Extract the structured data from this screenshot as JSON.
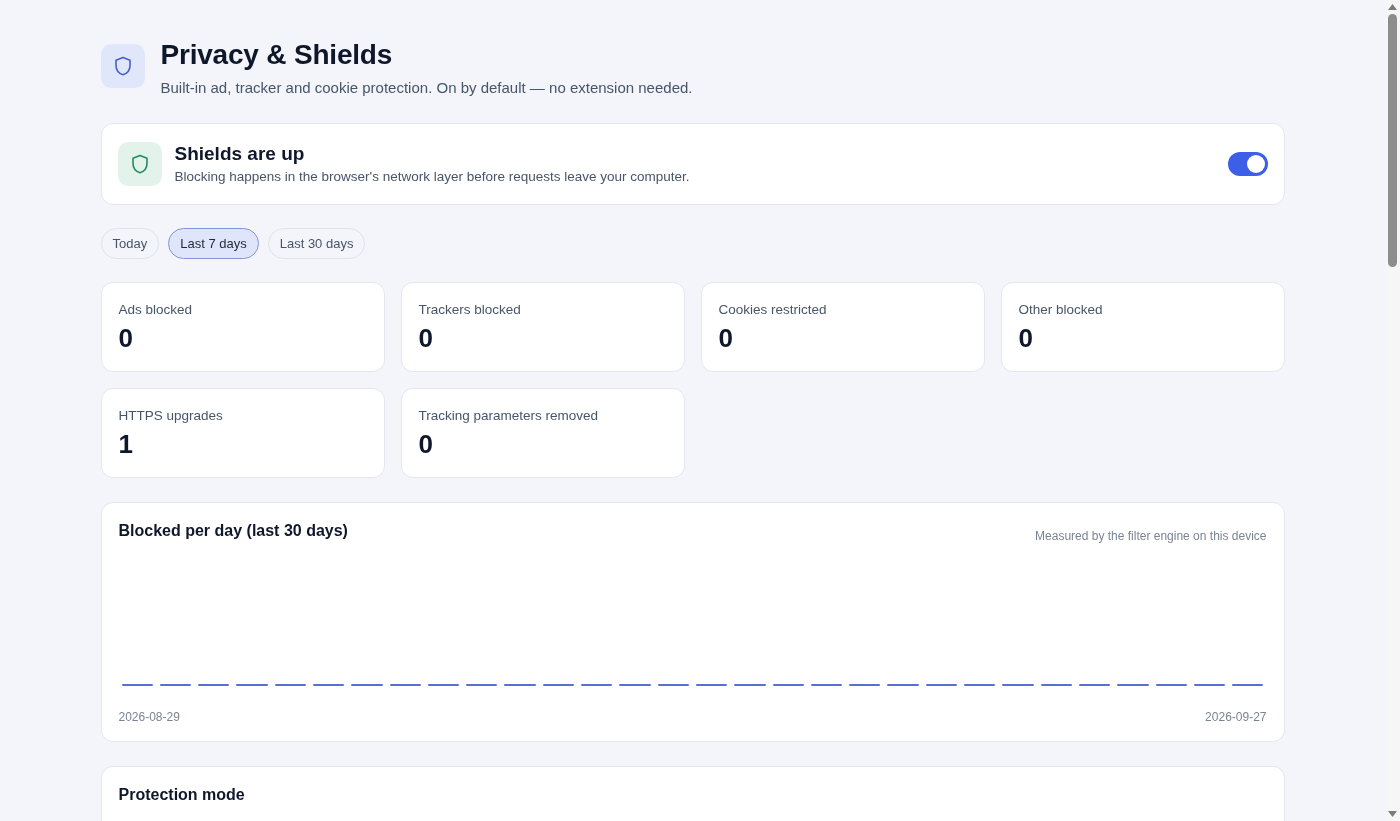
{
  "header": {
    "title": "Privacy & Shields",
    "subtitle": "Built-in ad, tracker and cookie protection. On by default — no extension needed."
  },
  "shields": {
    "title": "Shields are up",
    "description": "Blocking happens in the browser's network layer before requests leave your computer.",
    "on": true
  },
  "ranges": [
    {
      "label": "Today",
      "selected": false
    },
    {
      "label": "Last 7 days",
      "selected": true
    },
    {
      "label": "Last 30 days",
      "selected": false
    }
  ],
  "stats": [
    {
      "label": "Ads blocked",
      "value": "0"
    },
    {
      "label": "Trackers blocked",
      "value": "0"
    },
    {
      "label": "Cookies restricted",
      "value": "0"
    },
    {
      "label": "Other blocked",
      "value": "0"
    },
    {
      "label": "HTTPS upgrades",
      "value": "1"
    },
    {
      "label": "Tracking parameters removed",
      "value": "0"
    }
  ],
  "chart": {
    "title": "Blocked per day (last 30 days)",
    "note": "Measured by the filter engine on this device",
    "start_label": "2026-08-29",
    "end_label": "2026-09-27"
  },
  "protection_mode": {
    "title": "Protection mode"
  }
}
